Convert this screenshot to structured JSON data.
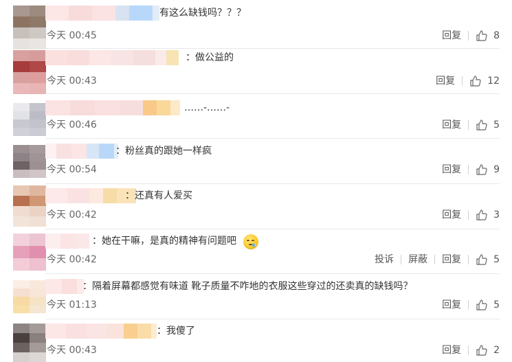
{
  "colors": {
    "text": "#333333",
    "meta": "#666666",
    "divider": "#e8e8e8"
  },
  "comments": [
    {
      "text": "有这么缺钱吗？？？",
      "time": "今天 00:45",
      "reply": "回复",
      "likes": "8"
    },
    {
      "text": "：做公益的",
      "time": "今天 00:43",
      "reply": "回复",
      "likes": "12"
    },
    {
      "text": "……-……-",
      "time": "今天 00:46",
      "reply": "回复",
      "likes": "5"
    },
    {
      "text": "：粉丝真的跟她一样疯",
      "time": "今天 00:54",
      "reply": "回复",
      "likes": "9"
    },
    {
      "text": "：还真有人爱买",
      "time": "今天 00:42",
      "reply": "回复",
      "likes": "3"
    },
    {
      "text": "：她在干嘛，是真的精神有问题吧",
      "time": "今天 00:42",
      "report": "投诉",
      "block": "屏蔽",
      "reply": "回复",
      "likes": "5",
      "emoji": "sweat-smile-emoji"
    },
    {
      "text": "：隔着屏幕都感觉有味道 靴子质量不咋地的衣服这些穿过的还卖真的缺钱吗？",
      "time": "今天 01:13",
      "reply": "回复",
      "likes": "5"
    },
    {
      "text": "：我傻了",
      "time": "今天 00:43",
      "reply": "回复",
      "likes": "2"
    }
  ]
}
